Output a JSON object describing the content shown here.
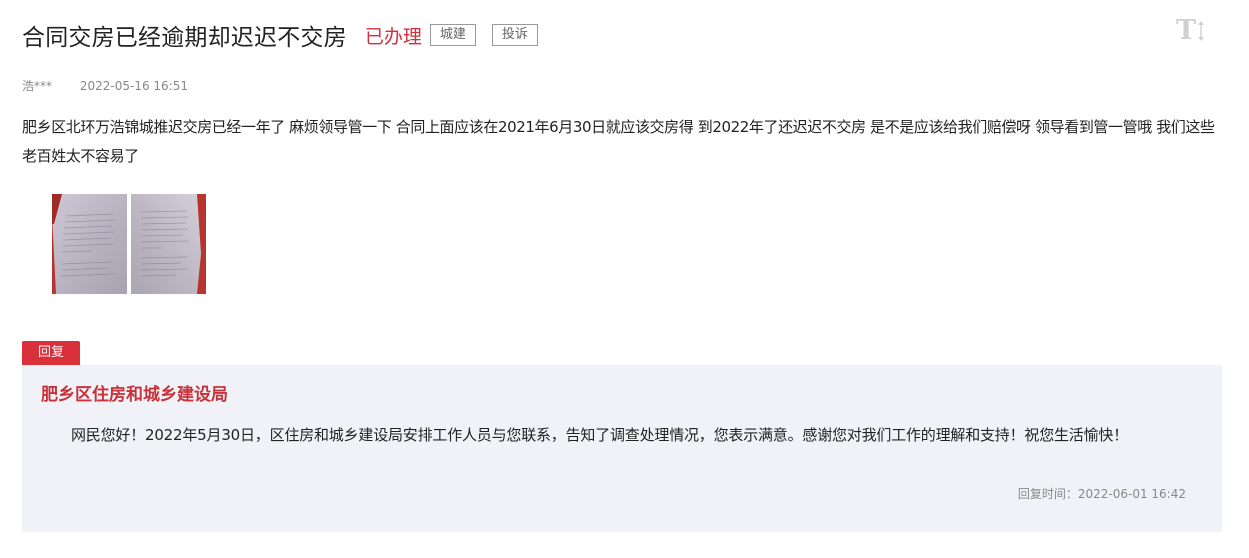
{
  "header": {
    "title": "合同交房已经逾期却迟迟不交房",
    "status": "已办理",
    "tags": [
      "城建",
      "投诉"
    ]
  },
  "toolbar": {
    "font_size_icon": "font-size-toggle-icon",
    "font_size_glyph": "T"
  },
  "meta": {
    "author": "浩***",
    "datetime": "2022-05-16 16:51"
  },
  "post": {
    "body": "肥乡区北环万浩锦城推迟交房已经一年了 麻烦领导管一下 合同上面应该在2021年6月30日就应该交房得 到2022年了还迟迟不交房 是不是应该给我们赔偿呀  领导看到管一管哦 我们这些老百姓太不容易了",
    "attachments": [
      {
        "icon": "document-photo-thumbnail"
      },
      {
        "icon": "document-photo-thumbnail"
      }
    ]
  },
  "reply": {
    "badge": "回复",
    "department": "肥乡区住房和城乡建设局",
    "content": "网民您好！2022年5月30日，区住房和城乡建设局安排工作人员与您联系，告知了调查处理情况，您表示满意。感谢您对我们工作的理解和支持！祝您生活愉快！",
    "time": "回复时间：2022-06-01 16:42"
  },
  "colors": {
    "accent_red": "#d9303a",
    "reply_background": "#f1f2f7",
    "muted_text": "#888888"
  }
}
